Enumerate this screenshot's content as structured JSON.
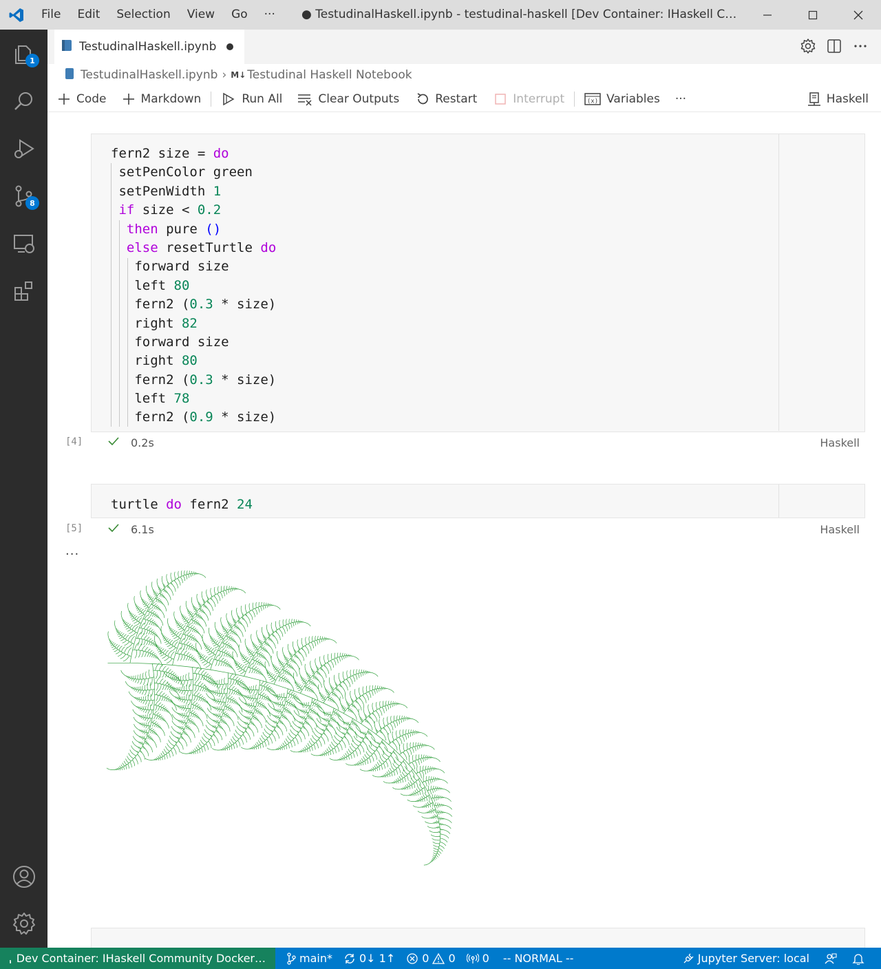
{
  "titlebar": {
    "menu": [
      "File",
      "Edit",
      "Selection",
      "View",
      "Go",
      "···"
    ],
    "window_title": "● TestudinalHaskell.ipynb - testudinal-haskell [Dev Container: IHaskell Co…"
  },
  "activity": {
    "explorer_badge": "1",
    "scm_badge": "8"
  },
  "tab": {
    "label": "TestudinalHaskell.ipynb"
  },
  "breadcrumb": {
    "file": "TestudinalHaskell.ipynb",
    "md_badge": "M↓",
    "section": "Testudinal Haskell Notebook"
  },
  "toolbar": {
    "code": "Code",
    "markdown": "Markdown",
    "run_all": "Run All",
    "clear_outputs": "Clear Outputs",
    "restart": "Restart",
    "interrupt": "Interrupt",
    "variables": "Variables",
    "more": "···",
    "kernel": "Haskell"
  },
  "cells": [
    {
      "exec_count": "[4]",
      "time": "0.2s",
      "language": "Haskell"
    },
    {
      "exec_count": "[5]",
      "time": "6.1s",
      "language": "Haskell"
    }
  ],
  "output_more": "···",
  "statusbar": {
    "remote": "Dev Container: IHaskell Community Docker…",
    "branch": "main*",
    "sync": "0↓ 1↑",
    "errors": "0",
    "warnings": "0",
    "ports": "0",
    "mode": "-- NORMAL --",
    "jupyter": "Jupyter Server: local"
  },
  "colors": {
    "accent": "#007acc",
    "remote": "#16825d",
    "activity_bg": "#2c2c2c",
    "keyword": "#af00db",
    "number": "#098658",
    "fern": "#2e9e3a"
  }
}
